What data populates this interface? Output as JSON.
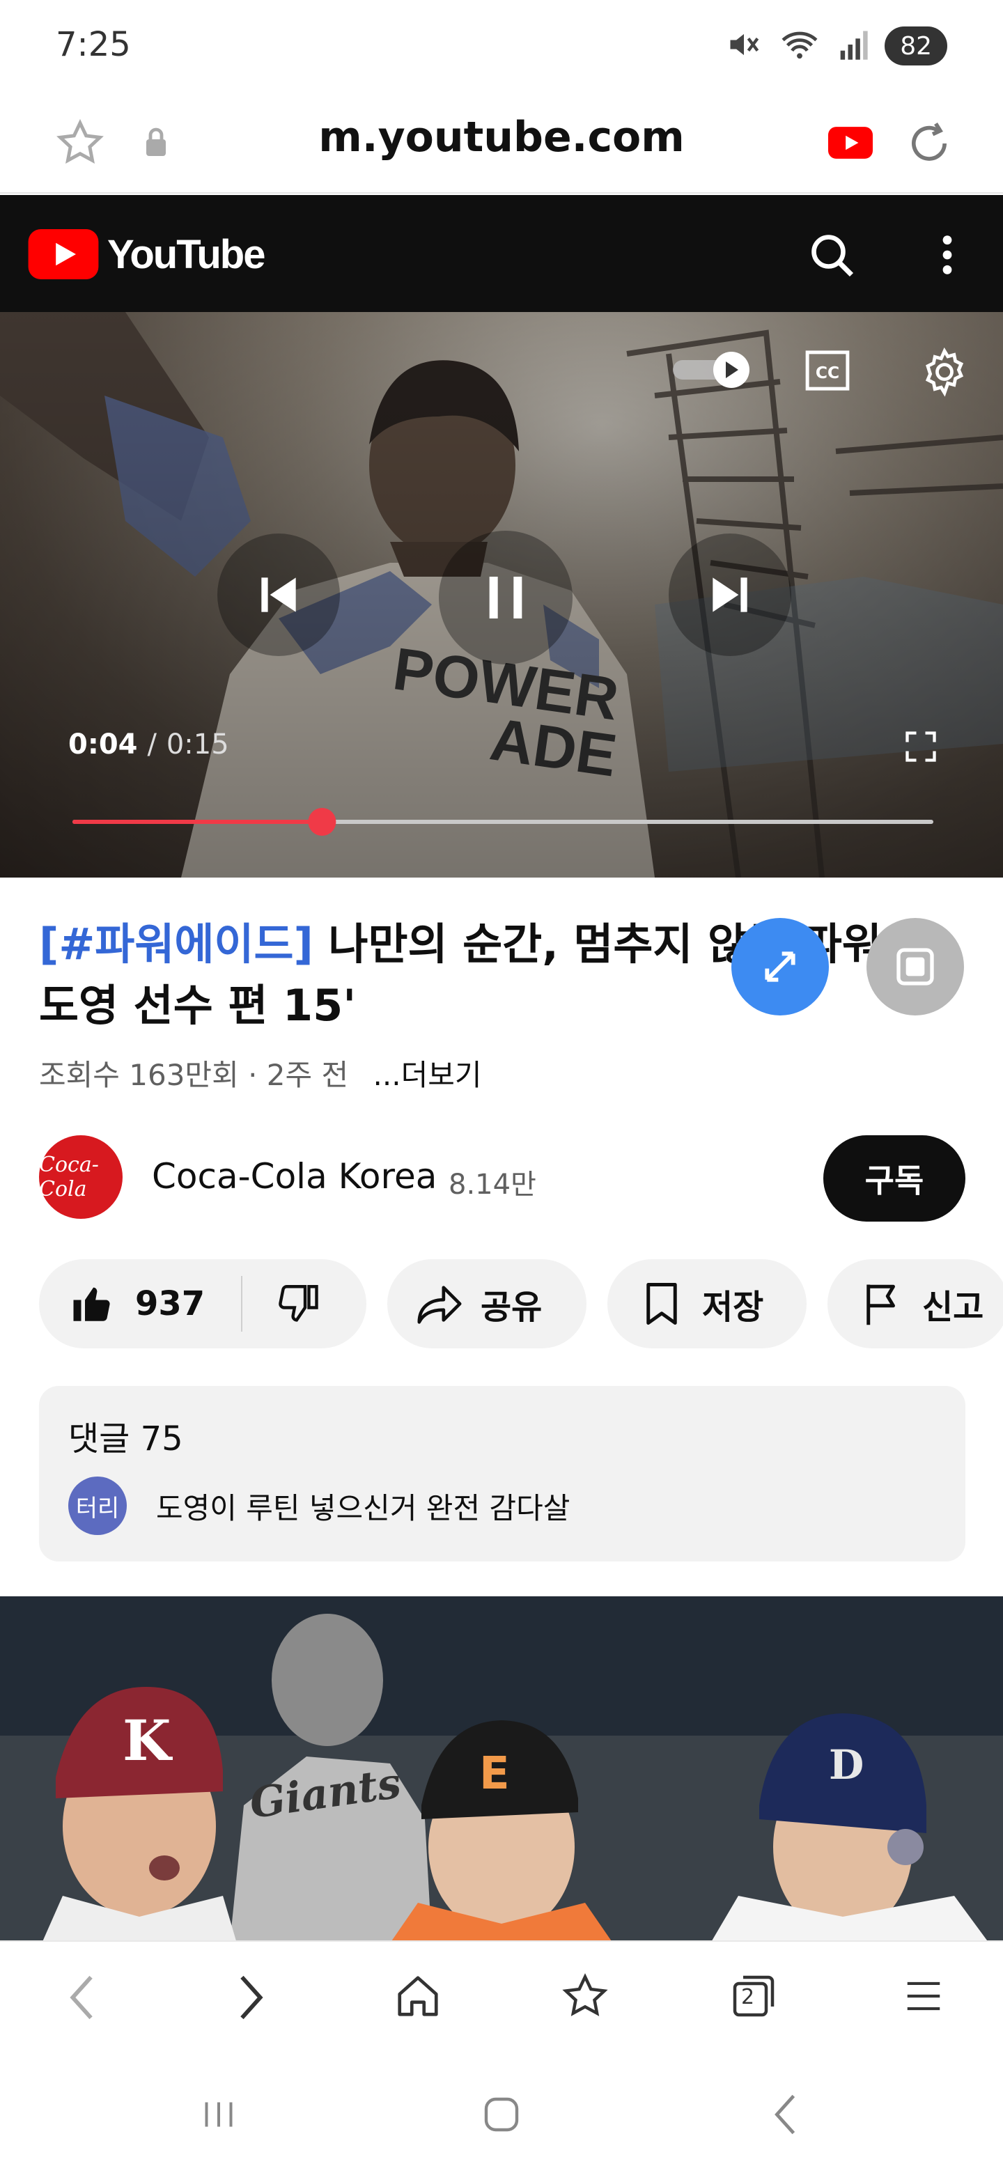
{
  "status_bar": {
    "time": "7:25",
    "battery": "82"
  },
  "browser": {
    "url": "m.youtube.com"
  },
  "youtube": {
    "logo_text": "YouTube"
  },
  "player": {
    "current_time": "0:04",
    "separator": "/",
    "duration": "0:15",
    "progress_fraction": 0.29,
    "autoplay_on": true
  },
  "video": {
    "title_hashtag": "[#파워에이드]",
    "title_rest": " 나만의 순간, 멈추지 않는 파워 김도영 선수 편 15'",
    "views": "조회수 163만회",
    "dot": "·",
    "age": "2주 전",
    "more": "...더보기"
  },
  "channel": {
    "avatar_text": "Coca-Cola",
    "name": "Coca-Cola Korea",
    "subscribers": "8.14만",
    "subscribe_label": "구독"
  },
  "actions": {
    "like_count": "937",
    "share_label": "공유",
    "save_label": "저장",
    "report_label": "신고"
  },
  "comments": {
    "title": "댓글 75",
    "commenter_avatar": "터리",
    "top_comment": "도영이 루틴 넣으신거 완전 감다살"
  },
  "colors": {
    "youtube_red": "#ff0000",
    "progress_red": "#f03a47",
    "hashtag_blue": "#3467d6",
    "float_blue": "#3d8bf2"
  },
  "bottom_nav": {
    "tabs_count": "2"
  }
}
